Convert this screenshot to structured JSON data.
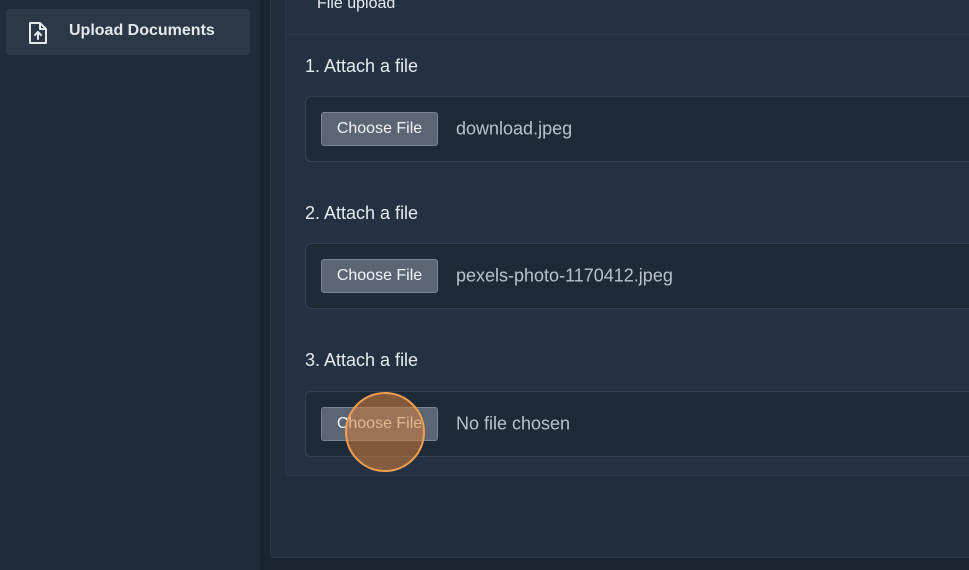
{
  "sidebar": {
    "items": [
      {
        "label": "Upload Documents",
        "icon": "file-upload-icon",
        "active": true
      }
    ]
  },
  "card": {
    "title": "File upload"
  },
  "fields": [
    {
      "label": "1. Attach a file",
      "button_label": "Choose File",
      "file_name": "download.jpeg"
    },
    {
      "label": "2. Attach a file",
      "button_label": "Choose File",
      "file_name": "pexels-photo-1170412.jpeg"
    },
    {
      "label": "3. Attach a file",
      "button_label": "Choose File",
      "file_name": "No file chosen"
    }
  ],
  "colors": {
    "background": "#1b2431",
    "sidebar": "#212c3b",
    "sidebar_active": "#2c3848",
    "card": "#243142",
    "button": "#5b6574",
    "click_marker": "#f0a050"
  }
}
